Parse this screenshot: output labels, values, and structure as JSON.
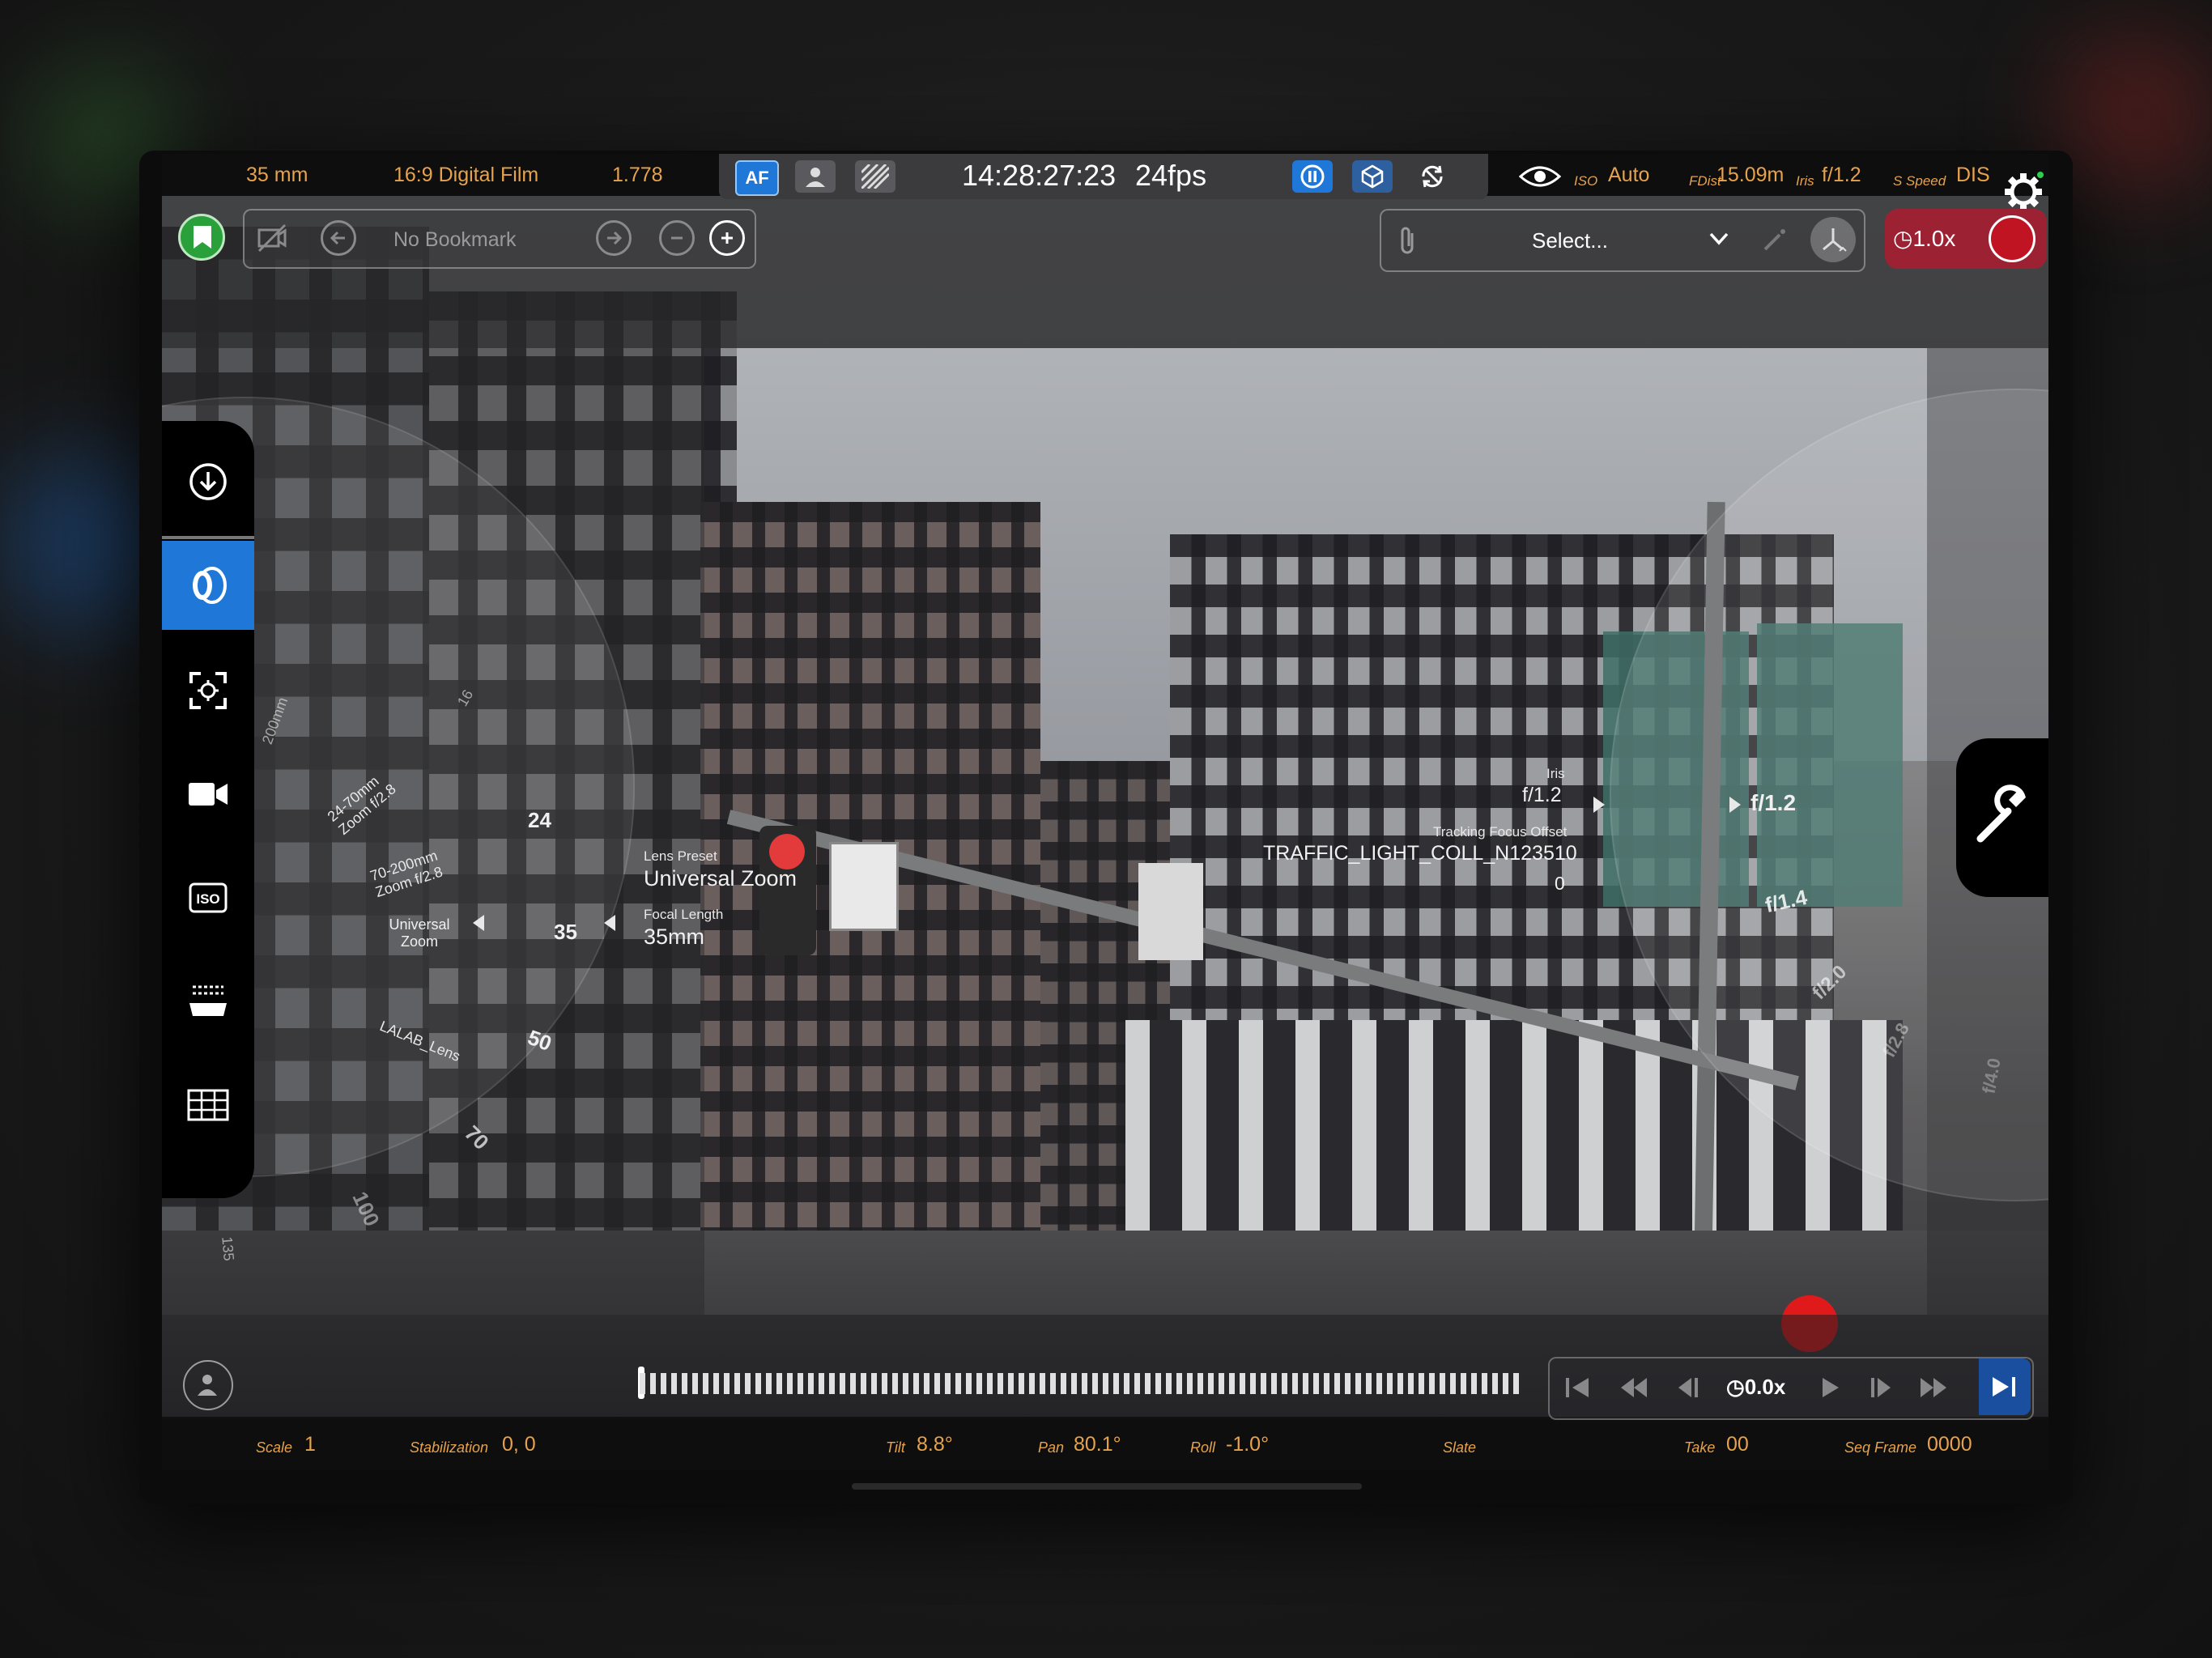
{
  "topbar": {
    "focal": "35 mm",
    "format": "16:9 Digital Film",
    "aspect": "1.778",
    "af_label": "AF",
    "timecode": "14:28:27:23",
    "fps": "24fps",
    "iso_label": "ISO",
    "iso_value": "Auto",
    "fdist_label": "FDist",
    "fdist_value": "15.09m",
    "iris_label": "Iris",
    "iris_value": "f/1.2",
    "speed_label": "S Speed",
    "speed_value": "DIS"
  },
  "bookmark": {
    "label": "No Bookmark"
  },
  "selector": {
    "label": "Select..."
  },
  "record": {
    "speed": "1.0x"
  },
  "lens_dial": {
    "ticks": [
      "16",
      "24",
      "35",
      "50",
      "70",
      "100",
      "135"
    ],
    "presets": [
      "200mm",
      "24-70mm Zoom f/2.8",
      "70-200mm Zoom f/2.8",
      "Universal Zoom",
      "LALAB_Lens"
    ],
    "lens_preset_label": "Lens Preset",
    "lens_preset_value": "Universal Zoom",
    "focal_length_label": "Focal Length",
    "focal_length_value": "35mm"
  },
  "iris_dial": {
    "iris_label": "Iris",
    "iris_value": "f/1.2",
    "tracking_label": "Tracking Focus Offset",
    "tracking_target": "TRAFFIC_LIGHT_COLL_N123510",
    "tracking_value": "0",
    "stops": [
      "f/1.2",
      "f/1.4",
      "f/2.0",
      "f/2.8",
      "f/4.0"
    ]
  },
  "transport": {
    "speed": "0.0x"
  },
  "bottombar": {
    "scale_label": "Scale",
    "scale_value": "1",
    "stab_label": "Stabilization",
    "stab_value": "0, 0",
    "tilt_label": "Tilt",
    "tilt_value": "8.8°",
    "pan_label": "Pan",
    "pan_value": "80.1°",
    "roll_label": "Roll",
    "roll_value": "-1.0°",
    "slate_label": "Slate",
    "take_label": "Take",
    "take_value": "00",
    "seq_label": "Seq Frame",
    "seq_value": "0000"
  },
  "colors": {
    "accent": "#e6a24c",
    "active": "#1f78d8",
    "record": "#c01423",
    "bookmark": "#2aa03a"
  }
}
